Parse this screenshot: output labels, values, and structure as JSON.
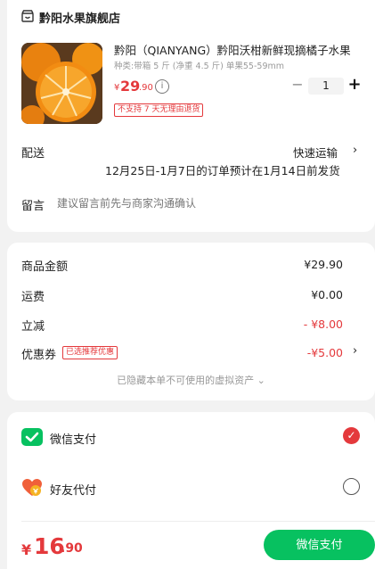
{
  "store": {
    "name": "黔阳水果旗舰店",
    "icon": "store-icon"
  },
  "product": {
    "title": "黔阳（QIANYANG）黔阳沃柑新鲜现摘橘子水果",
    "spec": "种类:带箱 5 斤 (净重 4.5 斤) 单果55-59mm",
    "price_symbol": "¥",
    "price_int": "29",
    "price_dec": ".90",
    "quantity": "1",
    "minus": "−",
    "plus": "+",
    "tag": "不支持 7 天无理由退货",
    "info_icon": "info-icon"
  },
  "shipping": {
    "label": "配送",
    "method": "快速运输",
    "eta": "12月25日-1月7日的订单预计在1月14日前发货",
    "chevron": "›"
  },
  "note": {
    "label": "留言",
    "placeholder": "建议留言前先与商家沟通确认"
  },
  "summary": {
    "goods_label": "商品金额",
    "goods_value": "¥29.90",
    "freight_label": "运费",
    "freight_value": "¥0.00",
    "discount_label": "立减",
    "discount_value": "- ¥8.00",
    "coupon_label": "优惠券",
    "coupon_badge": "已选推荐优惠",
    "coupon_value": "-¥5.00",
    "hidden_note": "已隐藏本单不可使用的虚拟资产 ⌄"
  },
  "payment": {
    "wechat_label": "微信支付",
    "friend_label": "好友代付",
    "wechat_icon": "wechat-pay-icon",
    "friend_icon": "friend-pay-icon",
    "check": "✓"
  },
  "total": {
    "symbol": "¥",
    "int": "16",
    "dec": ".90",
    "pay_button": "微信支付"
  },
  "colors": {
    "accent": "#e4393c",
    "wechat": "#07c160"
  }
}
